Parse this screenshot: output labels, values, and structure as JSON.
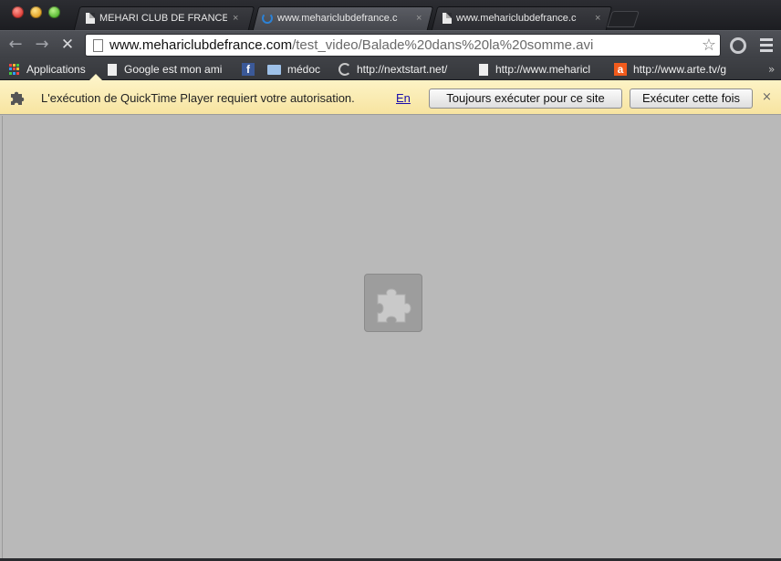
{
  "tabs": [
    {
      "title": "MEHARI CLUB DE FRANCE",
      "icon": "page-icon",
      "close": "×"
    },
    {
      "title": "www.mehariclubdefrance.c",
      "icon": "loading-spinner-icon",
      "close": "×"
    },
    {
      "title": "www.mehariclubdefrance.c",
      "icon": "page-icon",
      "close": "×"
    }
  ],
  "toolbar": {
    "back": "←",
    "forward": "→",
    "stop": "✕",
    "url_host": "www.mehariclubdefrance.com",
    "url_path": "/test_video/Balade%20dans%20la%20somme.avi",
    "star": "☆"
  },
  "bookmarks": [
    {
      "label": "Applications",
      "icon": "apps-grid-icon"
    },
    {
      "label": "Google est mon ami",
      "icon": "page-icon"
    },
    {
      "label": "",
      "icon": "facebook-icon"
    },
    {
      "label": "médoc",
      "icon": "folder-icon"
    },
    {
      "label": "http://nextstart.net/",
      "icon": "g-logo-icon"
    },
    {
      "label": "http://www.meharicl",
      "icon": "page-icon"
    },
    {
      "label": "http://www.arte.tv/g",
      "icon": "arte-icon"
    }
  ],
  "bookmarks_more": "»",
  "infobar": {
    "message": "L'exécution de QuickTime Player requiert votre autorisation.",
    "link": "En",
    "always_run": "Toujours exécuter pour ce site",
    "run_once": "Exécuter cette fois",
    "close": "×"
  },
  "colors": {
    "infobar_bg": "#fdf3c6",
    "content_bg": "#b9b9b9",
    "plugin_bg": "#9d9d9d"
  }
}
